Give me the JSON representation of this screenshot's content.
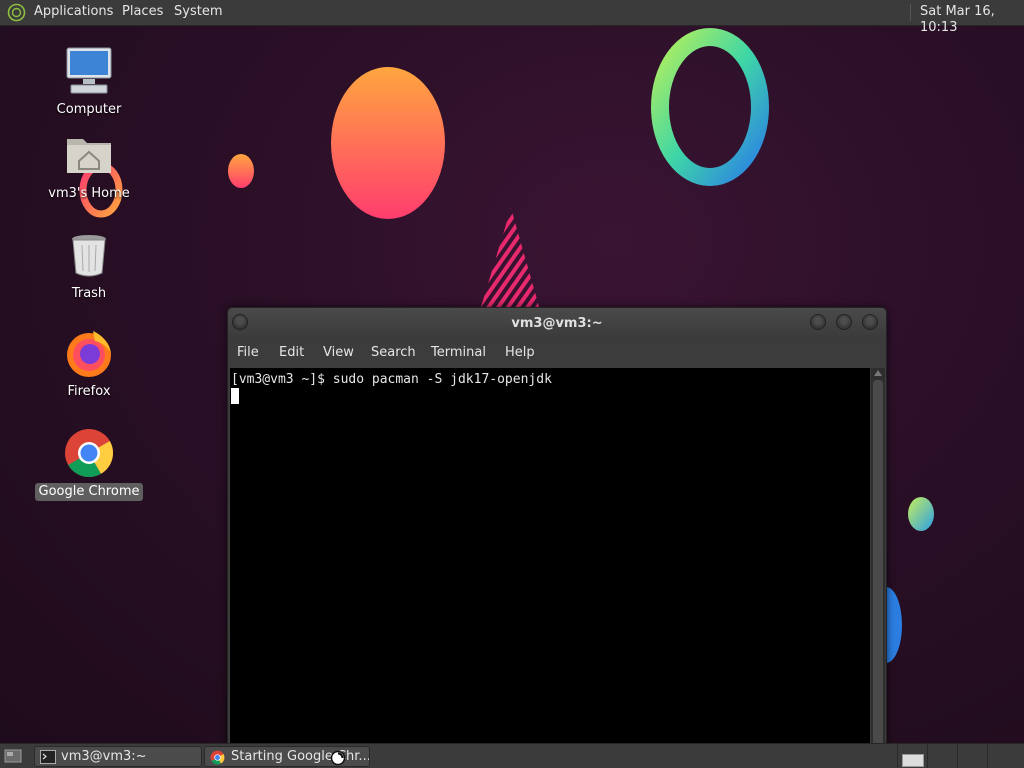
{
  "top_panel": {
    "menus": [
      "Applications",
      "Places",
      "System"
    ],
    "clock": "Sat Mar 16, 10:13"
  },
  "desktop_icons": [
    {
      "label": "Computer",
      "icon": "computer-icon"
    },
    {
      "label": "vm3's Home",
      "icon": "home-folder-icon"
    },
    {
      "label": "Trash",
      "icon": "trash-icon"
    },
    {
      "label": "Firefox",
      "icon": "firefox-icon"
    },
    {
      "label": "Google Chrome",
      "icon": "chrome-icon",
      "selected": true
    }
  ],
  "terminal": {
    "title": "vm3@vm3:~",
    "menu": [
      "File",
      "Edit",
      "View",
      "Search",
      "Terminal",
      "Help"
    ],
    "prompt_line": "[vm3@vm3 ~]$ sudo pacman -S jdk17-openjdk",
    "background": "#000000",
    "foreground": "#e6e6e6"
  },
  "taskbar": {
    "tasks": [
      {
        "label": "vm3@vm3:~",
        "icon": "terminal-icon"
      },
      {
        "label": "Starting Google Chr...",
        "icon": "chrome-icon"
      }
    ]
  },
  "colors": {
    "panel": "#3b3b3b",
    "wallpaper": "#2a0f26"
  }
}
